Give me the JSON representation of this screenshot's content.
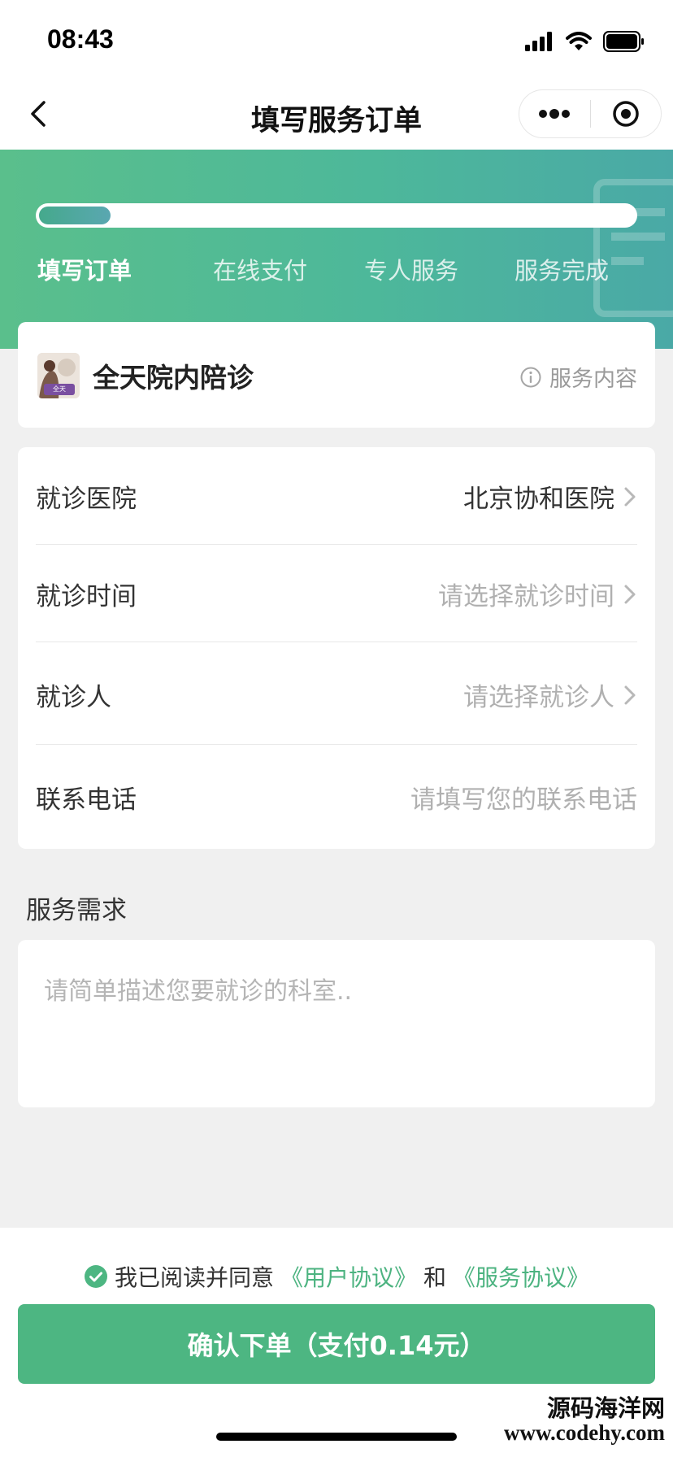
{
  "status_bar": {
    "time": "08:43"
  },
  "nav": {
    "title": "填写服务订单"
  },
  "progress": {
    "fraction": 0.12,
    "steps": [
      {
        "label": "填写订单",
        "active": true
      },
      {
        "label": "在线支付",
        "active": false
      },
      {
        "label": "专人服务",
        "active": false
      },
      {
        "label": "服务完成",
        "active": false
      }
    ]
  },
  "service": {
    "title": "全天院内陪诊",
    "thumb_badge": "全天",
    "info_label": "服务内容"
  },
  "form": {
    "rows": [
      {
        "label": "就诊医院",
        "value": "北京协和医院",
        "state": "filled",
        "chevron": true
      },
      {
        "label": "就诊时间",
        "value": "请选择就诊时间",
        "state": "placeholder",
        "chevron": true
      },
      {
        "label": "就诊人",
        "value": "请选择就诊人",
        "state": "placeholder",
        "chevron": true
      },
      {
        "label": "联系电话",
        "value": "请填写您的联系电话",
        "state": "placeholder",
        "chevron": false
      }
    ]
  },
  "requirements": {
    "title": "服务需求",
    "placeholder": "请简单描述您要就诊的科室.."
  },
  "agreement": {
    "prefix": "我已阅读并同意",
    "user_link": "《用户协议》",
    "conjunction": "和",
    "service_link": "《服务协议》",
    "checked": true
  },
  "confirm": {
    "label": "确认下单（支付0.14元）"
  },
  "watermark": {
    "name": "源码海洋网",
    "url": "www.codehy.com"
  },
  "colors": {
    "accent": "#4db682",
    "header_start": "#5abf8c",
    "header_end": "#4aa9a6",
    "link": "#4cb380"
  }
}
